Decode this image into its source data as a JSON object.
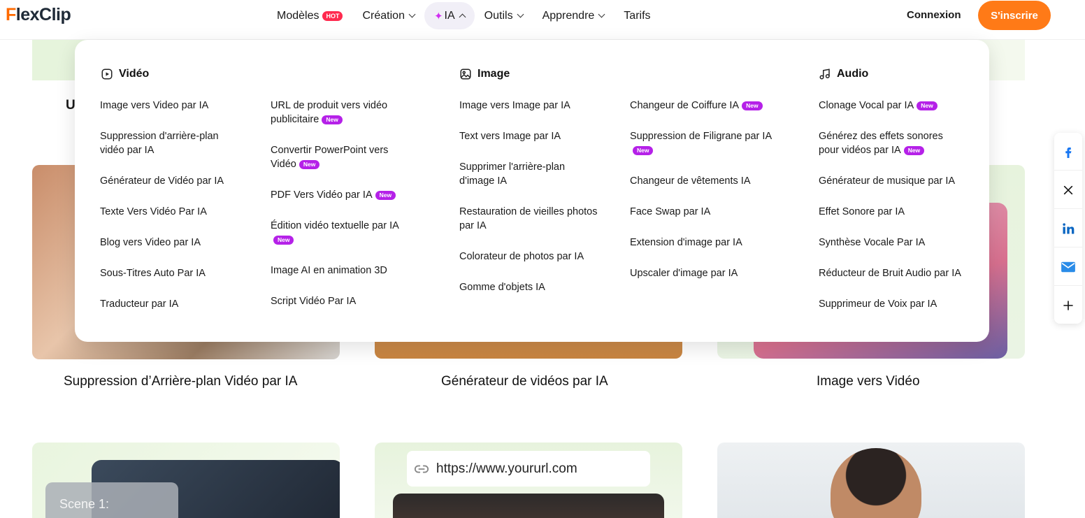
{
  "header": {
    "logo": {
      "accent": "F",
      "rest": "lexClip"
    },
    "nav": [
      {
        "label": "Modèles",
        "badge": "HOT"
      },
      {
        "label": "Création"
      },
      {
        "label": "IA",
        "active": true
      },
      {
        "label": "Outils"
      },
      {
        "label": "Apprendre"
      },
      {
        "label": "Tarifs"
      }
    ],
    "login": "Connexion",
    "signup": "S'inscrire"
  },
  "colors": {
    "accent": "#ff7a17",
    "new_badge": "#b521e8",
    "hot_badge": "#ff2a4f"
  },
  "ai_menu": {
    "video": {
      "title": "Vidéo",
      "col1": [
        "Image vers Video par IA",
        "Suppression d'arrière-plan vidéo par IA",
        "Générateur de Vidéo par IA",
        "Texte Vers Vidéo Par IA",
        "Blog vers Video par IA",
        "Sous-Titres Auto Par IA",
        "Traducteur par IA"
      ],
      "col2": [
        "URL de produit vers vidéo publicitaire",
        "Convertir PowerPoint vers Vidéo",
        "PDF Vers Vidéo par IA",
        "Édition vidéo textuelle par IA",
        "Image AI en animation 3D",
        "Script Vidéo Par IA"
      ]
    },
    "image": {
      "title": "Image",
      "col1": [
        "Image vers Image par IA",
        "Text vers Image par IA",
        "Supprimer l'arrière-plan d'image IA",
        "Restauration de vieilles photos par IA",
        "Colorateur de photos par IA",
        "Gomme d'objets IA"
      ],
      "col2": [
        "Changeur de Coiffure IA",
        "Suppression de Filigrane par IA",
        "Changeur de vêtements IA",
        "Face Swap par IA",
        "Extension d'image par IA",
        "Upscaler d'image par IA"
      ]
    },
    "audio": {
      "title": "Audio",
      "col1": [
        "Clonage Vocal par IA",
        "Générez des effets sonores pour vidéos par IA",
        "Générateur de musique par IA",
        "Effet Sonore par IA",
        "Synthèse Vocale Par IA",
        "Réducteur de Bruit Audio par IA",
        "Supprimeur de Voix par IA"
      ]
    },
    "new_label": "New"
  },
  "page": {
    "partial_heading": "U",
    "cards": [
      "Suppression d’Arrière-plan Vidéo par IA",
      "Générateur de vidéos par IA",
      "Image vers Vidéo"
    ],
    "scene_label": "Scene 1:",
    "url_text": "https://www.yoururl.com"
  },
  "share": [
    "facebook-icon",
    "x-icon",
    "linkedin-icon",
    "mail-icon",
    "plus-icon"
  ]
}
